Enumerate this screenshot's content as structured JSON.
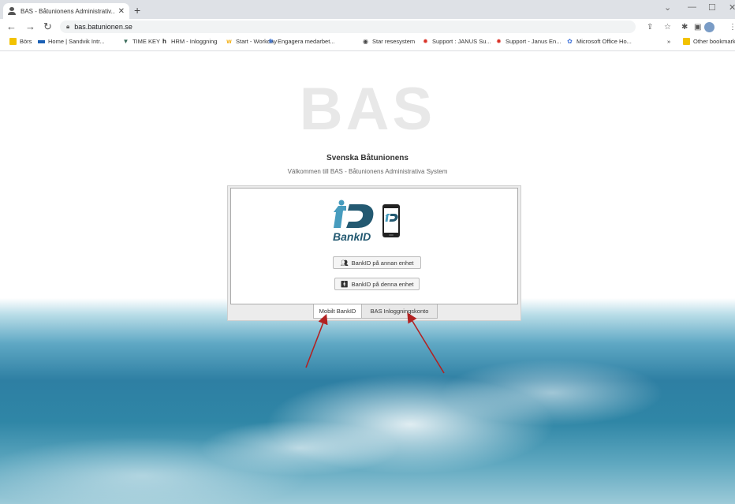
{
  "browser": {
    "tab_title": "BAS - Båtunionens Administrativ...",
    "url": "bas.batunionen.se",
    "bookmarks": [
      {
        "label": "Börs",
        "icon": "folder-icon",
        "color": "#f2c200"
      },
      {
        "label": "Home | Sandvik Intr...",
        "icon": "sandvik-icon",
        "color": "#1a5fb4"
      },
      {
        "label": "TIME KEY",
        "icon": "timekey-icon",
        "color": "#3a6b5a"
      },
      {
        "label": "HRM - Inloggning",
        "icon": "hrm-icon",
        "color": "#222222"
      },
      {
        "label": "Start - Workday",
        "icon": "workday-icon",
        "color": "#f2a900"
      },
      {
        "label": "Engagera medarbet...",
        "icon": "engage-icon",
        "color": "#2a6ad8"
      },
      {
        "label": "Star resesystem",
        "icon": "star-resesystem-icon",
        "color": "#444444"
      },
      {
        "label": "Support : JANUS Su...",
        "icon": "janus-icon",
        "color": "#d93025"
      },
      {
        "label": "Support - Janus En...",
        "icon": "janus-icon",
        "color": "#d93025"
      },
      {
        "label": "Microsoft Office Ho...",
        "icon": "office-icon",
        "color": "#3b6fd8"
      }
    ],
    "more_bookmarks": "»",
    "other_bookmarks": "Other bookmarks"
  },
  "page": {
    "logo_text": "BAS",
    "org_name": "Svenska Båtunionens",
    "welcome": "Välkommen till BAS - Båtunionens Administrativa System",
    "bankid_label": "BankID",
    "buttons": {
      "other_device": "BankID på annan enhet",
      "this_device": "BankID på denna enhet"
    },
    "tabs": [
      "Mobilt BankID",
      "BAS Inloggningskonto"
    ],
    "active_tab": "Mobilt BankID"
  },
  "colors": {
    "bankid_blue": "#235971",
    "bankid_light": "#479cbe",
    "arrow": "#b22222",
    "logo_gray": "#e8e8e8"
  }
}
